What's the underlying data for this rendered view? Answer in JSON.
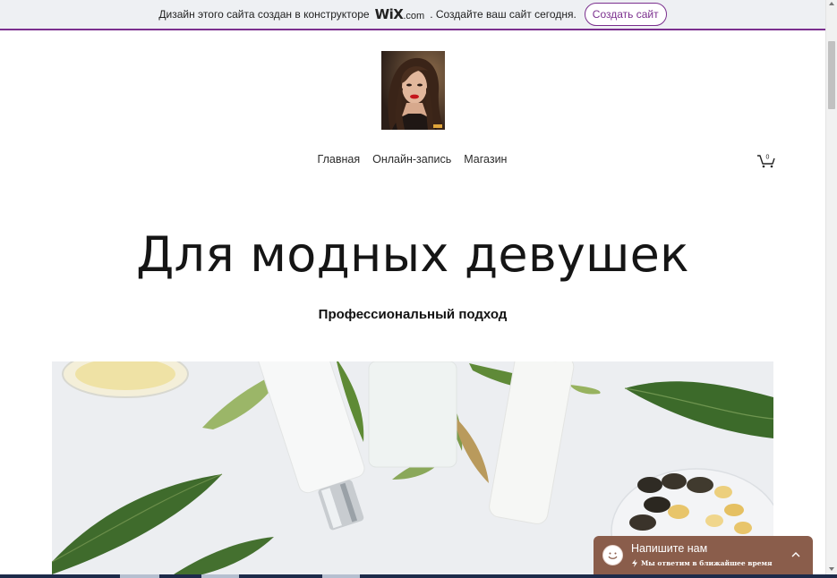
{
  "banner": {
    "text_before": "Дизайн этого сайта создан в конструкторе",
    "logo_wix": "WiX",
    "logo_dotcom": ".com",
    "text_after": ". Создайте ваш сайт сегодня.",
    "button_label": "Создать сайт",
    "accent_color": "#7b2f8e"
  },
  "nav": {
    "items": [
      {
        "label": "Главная"
      },
      {
        "label": "Онлайн-запись"
      },
      {
        "label": "Магазин"
      }
    ],
    "cart_count": "0"
  },
  "hero": {
    "title": "Для модных девушек",
    "subtitle": "Профессиональный подход"
  },
  "chat": {
    "title": "Напишите нам",
    "subtitle": "Мы ответим в ближайшее время",
    "color": "#8a5d4b"
  }
}
